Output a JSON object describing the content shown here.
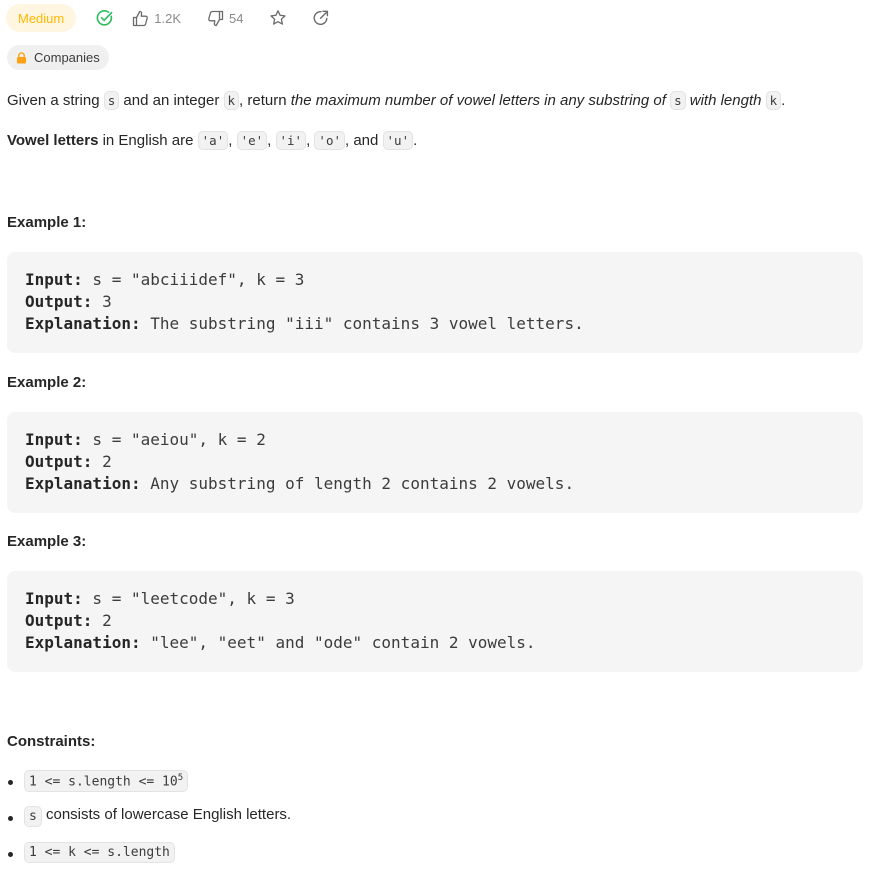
{
  "header": {
    "difficulty": "Medium",
    "likes": "1.2K",
    "dislikes": "54",
    "companies_label": "Companies"
  },
  "description": {
    "p1_a": "Given a string ",
    "p1_s": "s",
    "p1_b": " and an integer ",
    "p1_k": "k",
    "p1_c": ", return ",
    "p1_em1": "the maximum number of vowel letters in any substring of ",
    "p1_s2": "s",
    "p1_em2": " with length ",
    "p1_k2": "k",
    "p1_d": ".",
    "p2_bold": "Vowel letters",
    "p2_a": " in English are ",
    "v1": "'a'",
    "v2": "'e'",
    "v3": "'i'",
    "v4": "'o'",
    "v5": "'u'",
    "sep": ", ",
    "and": ", and ",
    "p2_end": "."
  },
  "labels": {
    "input": "Input:",
    "output": "Output:",
    "explanation": "Explanation:"
  },
  "examples": [
    {
      "title": "Example 1:",
      "input": " s = \"abciiidef\", k = 3",
      "output": " 3",
      "explanation": " The substring \"iii\" contains 3 vowel letters."
    },
    {
      "title": "Example 2:",
      "input": " s = \"aeiou\", k = 2",
      "output": " 2",
      "explanation": " Any substring of length 2 contains 2 vowels."
    },
    {
      "title": "Example 3:",
      "input": " s = \"leetcode\", k = 3",
      "output": " 2",
      "explanation": " \"lee\", \"eet\" and \"ode\" contain 2 vowels."
    }
  ],
  "constraints": {
    "title": "Constraints:",
    "c1_code": "1 <= s.length <= 10",
    "c1_sup": "5",
    "c2_code": "s",
    "c2_text": " consists of lowercase English letters.",
    "c3_code": "1 <= k <= s.length"
  },
  "colors": {
    "medium_text": "#ffb800",
    "medium_bg": "#fff6e1",
    "solved_check": "#2cbb5d",
    "lock": "#ffa116",
    "code_bg": "#f5f5f5"
  }
}
